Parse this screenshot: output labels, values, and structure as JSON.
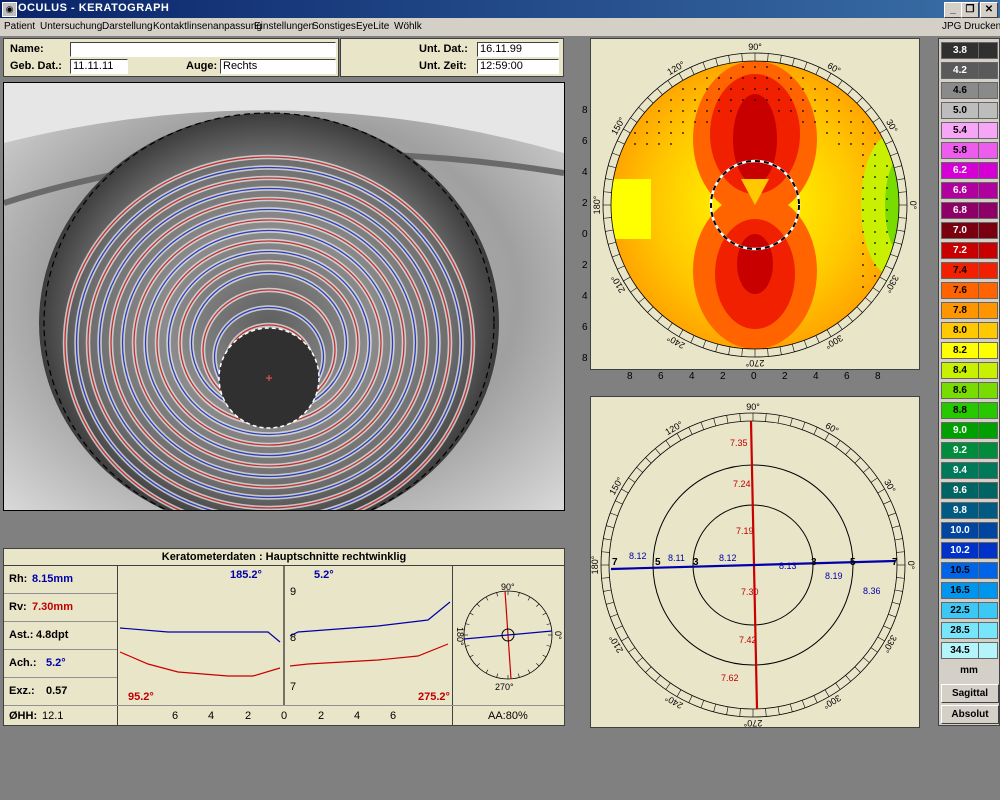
{
  "window": {
    "title": "OCULUS  -  KERATOGRAPH"
  },
  "menu": {
    "items": [
      "Patient",
      "Untersuchung",
      "Darstellung",
      "Kontaktlinsenanpassung",
      "Einstellungen",
      "Sonstiges",
      "EyeLite",
      "Wöhlk"
    ],
    "right": [
      "JPG",
      "Drucken"
    ]
  },
  "header": {
    "name_label": "Name:",
    "name_value": "",
    "geb_label": "Geb. Dat.:",
    "geb_value": "11.11.11",
    "auge_label": "Auge:",
    "auge_value": "Rechts",
    "unt_dat_label": "Unt. Dat.:",
    "unt_dat_value": "16.11.99",
    "unt_zeit_label": "Unt. Zeit:",
    "unt_zeit_value": "12:59:00"
  },
  "topo": {
    "angles": [
      "90°",
      "60°",
      "30°",
      "0°",
      "330°",
      "300°",
      "270°",
      "240°",
      "210°",
      "180°",
      "150°",
      "120°"
    ],
    "y_ticks": [
      "8",
      "6",
      "4",
      "2",
      "0",
      "2",
      "4",
      "6",
      "8"
    ],
    "x_ticks": [
      "8",
      "6",
      "4",
      "2",
      "0",
      "2",
      "4",
      "6",
      "8"
    ]
  },
  "meridian": {
    "angles": [
      "90°",
      "60°",
      "30°",
      "0°",
      "330°",
      "300°",
      "270°",
      "240°",
      "210°",
      "180°",
      "150°",
      "120°"
    ],
    "rings": [
      "3",
      "5",
      "7",
      "3",
      "5",
      "7"
    ],
    "vertical_values": [
      "7.35",
      "7.24",
      "7.19",
      "7.30",
      "7.42",
      "7.62"
    ],
    "horizontal_values": [
      "8.12",
      "8.11",
      "8.12",
      "8.13",
      "8.19",
      "8.36"
    ]
  },
  "kerato": {
    "title": "Keratometerdaten : Hauptschnitte rechtwinklig",
    "rh_label": "Rh:",
    "rh_value": "8.15mm",
    "rv_label": "Rv:",
    "rv_value": "7.30mm",
    "ast_label": "Ast.:",
    "ast_value": "4.8dpt",
    "ach_label": "Ach.:",
    "ach_value": "5.2°",
    "exz_label": "Exz.:",
    "exz_value": "0.57",
    "ohh_label": "ØHH:",
    "ohh_value": "12.1",
    "angle_top_left": "185.2°",
    "angle_top_right": "5.2°",
    "angle_bot_left": "95.2°",
    "angle_bot_right": "275.2°",
    "y_ticks": [
      "9",
      "8",
      "7"
    ],
    "x_ticks": [
      "6",
      "4",
      "2",
      "0",
      "2",
      "4",
      "6"
    ],
    "mini_angles": [
      "90°",
      "0°",
      "270°",
      "180°"
    ],
    "aa": "AA:80%"
  },
  "scale": {
    "items": [
      {
        "v": "3.8",
        "c": "#303030"
      },
      {
        "v": "4.2",
        "c": "#5a5a5a"
      },
      {
        "v": "4.6",
        "c": "#8a8a8a"
      },
      {
        "v": "5.0",
        "c": "#bdbdbd"
      },
      {
        "v": "5.4",
        "c": "#f7a6f7"
      },
      {
        "v": "5.8",
        "c": "#ee5cee"
      },
      {
        "v": "6.2",
        "c": "#d400d4"
      },
      {
        "v": "6.6",
        "c": "#b0009e"
      },
      {
        "v": "6.8",
        "c": "#8e0068"
      },
      {
        "v": "7.0",
        "c": "#7a0010"
      },
      {
        "v": "7.2",
        "c": "#c80000"
      },
      {
        "v": "7.4",
        "c": "#f02000"
      },
      {
        "v": "7.6",
        "c": "#ff6400"
      },
      {
        "v": "7.8",
        "c": "#ff9600"
      },
      {
        "v": "8.0",
        "c": "#ffc800"
      },
      {
        "v": "8.2",
        "c": "#ffff00"
      },
      {
        "v": "8.4",
        "c": "#c8f000"
      },
      {
        "v": "8.6",
        "c": "#78dc00"
      },
      {
        "v": "8.8",
        "c": "#28c800"
      },
      {
        "v": "9.0",
        "c": "#00a000"
      },
      {
        "v": "9.2",
        "c": "#008c3c"
      },
      {
        "v": "9.4",
        "c": "#00785a"
      },
      {
        "v": "9.6",
        "c": "#006464"
      },
      {
        "v": "9.8",
        "c": "#005a82"
      },
      {
        "v": "10.0",
        "c": "#0046a0"
      },
      {
        "v": "10.2",
        "c": "#0032c8"
      },
      {
        "v": "10.5",
        "c": "#0064e6"
      },
      {
        "v": "16.5",
        "c": "#0096f0"
      },
      {
        "v": "22.5",
        "c": "#3cc8f5"
      },
      {
        "v": "28.5",
        "c": "#78e6fa"
      },
      {
        "v": "34.5",
        "c": "#b4f5fc"
      }
    ],
    "unit": "mm",
    "btn_sagittal": "Sagittal",
    "btn_absolut": "Absolut"
  }
}
